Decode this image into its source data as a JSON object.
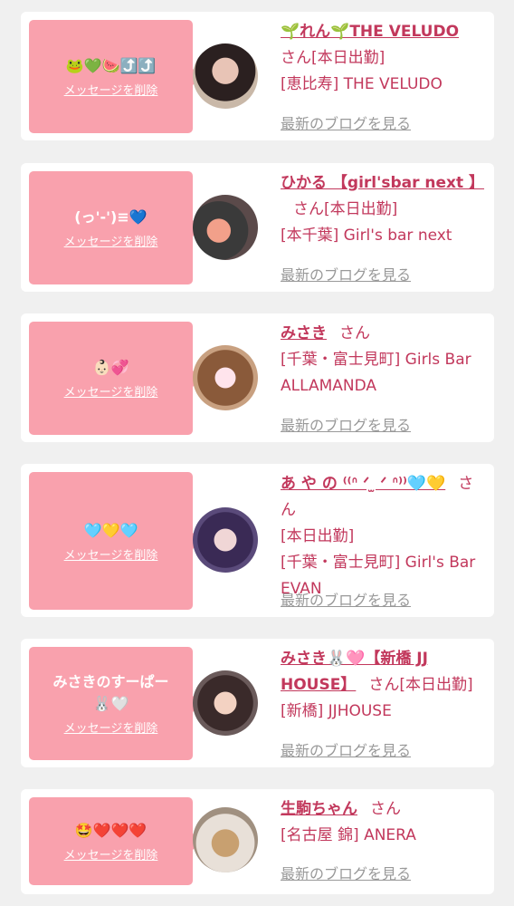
{
  "cards": [
    {
      "message": "🐸💚🍉⤴️⤴️",
      "delete_label": "メッセージを削除",
      "name": "🌱れん🌱THE VELUDO",
      "honorific": "さん",
      "status": "[本日出勤]",
      "shop": "[恵比寿] THE VELUDO",
      "blog_label": "最新のブログを見る"
    },
    {
      "message": "(っ'-')≡💙",
      "delete_label": "メッセージを削除",
      "name": "ひかる 【girl'sbar next 】",
      "honorific": "さん",
      "status": "[本日出勤]",
      "shop": "[本千葉] Girl's bar next",
      "blog_label": "最新のブログを見る"
    },
    {
      "message": "👶🏻💞",
      "delete_label": "メッセージを削除",
      "name": "みさき",
      "honorific": "さん",
      "status": "",
      "shop": "[千葉・富士見町] Girls Bar ALLAMANDA",
      "blog_label": "最新のブログを見る"
    },
    {
      "message": "🩵💛🩵",
      "delete_label": "メッセージを削除",
      "name": "あ や の ⁽⁽ᐢ ᐟ ̫ ᐟ ᐢ⁾⁾🩵💛",
      "honorific": "さん",
      "status": "[本日出勤]",
      "shop": "[千葉・富士見町] Girl's Bar EVAN",
      "blog_label": "最新のブログを見る"
    },
    {
      "message": "みさきのすーぱー\n🐰🤍",
      "delete_label": "メッセージを削除",
      "name": "みさき🐰🩷【新橋 JJ HOUSE】",
      "honorific": "さん",
      "status": "[本日出勤]",
      "shop": "[新橋] JJHOUSE",
      "blog_label": "最新のブログを見る"
    },
    {
      "message": "🤩❤️❤️❤️",
      "delete_label": "メッセージを削除",
      "name": "生駒ちゃん",
      "honorific": "さん",
      "status": "",
      "shop": "[名古屋 錦] ANERA",
      "blog_label": "最新のブログを見る"
    }
  ]
}
